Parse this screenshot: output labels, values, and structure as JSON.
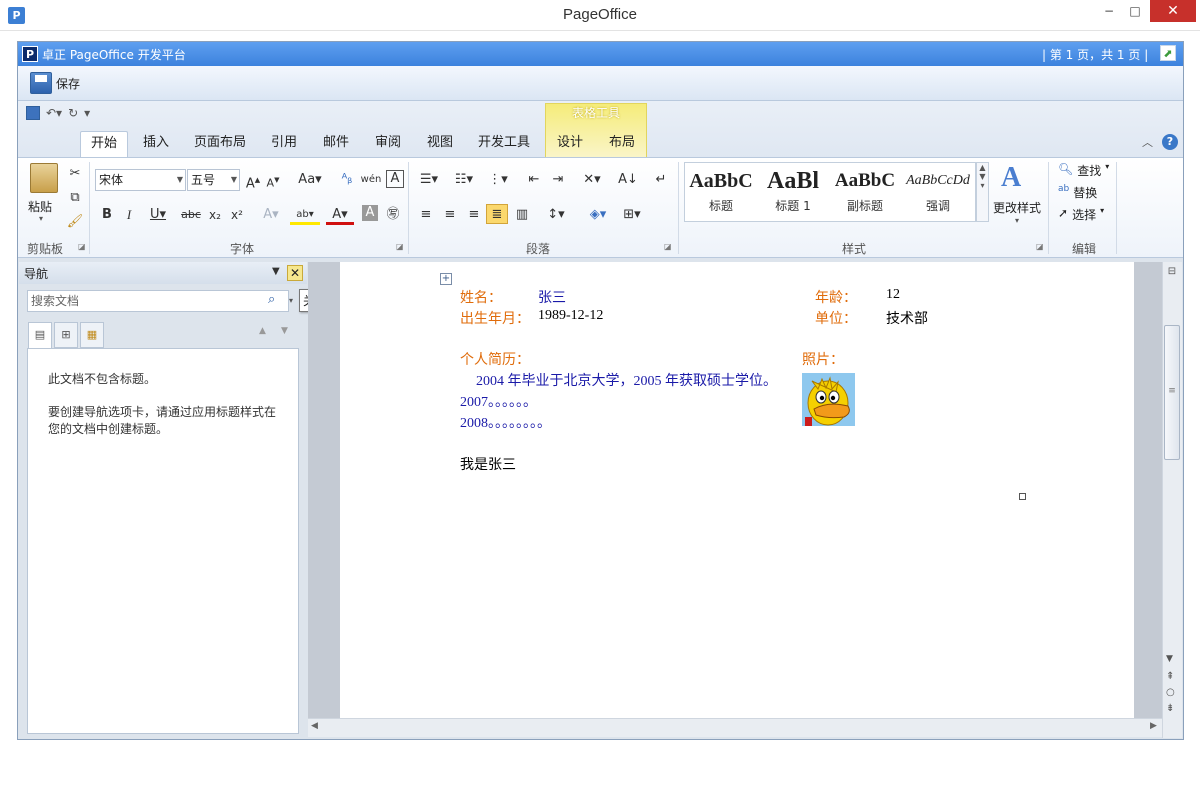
{
  "window": {
    "title": "PageOffice",
    "app_icon": "P",
    "min": "−",
    "max": "□",
    "close": "✕"
  },
  "po": {
    "logo": "P",
    "title": "卓正 PageOffice 开发平台",
    "page_info": "| 第 1 页，共 1 页 |",
    "save_label": "保存"
  },
  "ribbon": {
    "context_group": "表格工具",
    "tabs": [
      "开始",
      "插入",
      "页面布局",
      "引用",
      "邮件",
      "审阅",
      "视图",
      "开发工具",
      "设计",
      "布局"
    ],
    "groups": {
      "clipboard": "剪贴板",
      "font": "字体",
      "paragraph": "段落",
      "styles": "样式",
      "editing": "编辑"
    },
    "paste_label": "粘贴",
    "font_name": "宋体",
    "font_size": "五号",
    "change_styles": "更改样式",
    "styles": [
      {
        "sample": "AaBbC",
        "name": "标题"
      },
      {
        "sample": "AaBl",
        "name": "标题 1"
      },
      {
        "sample": "AaBbC",
        "name": "副标题"
      },
      {
        "sample": "AaBbCcDd",
        "name": "强调"
      }
    ],
    "editing": {
      "find": "查找",
      "replace": "替换",
      "select": "选择"
    }
  },
  "nav": {
    "title": "导航",
    "close_tooltip": "关闭",
    "search_placeholder": "搜索文档",
    "message1": "此文档不包含标题。",
    "message2": "要创建导航选项卡，请通过应用标题样式在您的文档中创建标题。"
  },
  "document": {
    "name_label": "姓名：",
    "name_value": "张三",
    "age_label": "年龄：",
    "age_value": "12",
    "birth_label": "出生年月：",
    "birth_value": "1989-12-12",
    "unit_label": "单位：",
    "unit_value": "技术部",
    "resume_label": "个人简历：",
    "photo_label": "照片：",
    "resume_lines": [
      "2004 年毕业于北京大学，2005 年获取硕士学位。",
      "2007。。。。。。",
      "2008。。。。。。。。"
    ],
    "footer_text": "我是张三"
  },
  "colors": {
    "label": "#e06c0b",
    "value_blue": "#1a1aa8",
    "close_button": "#c7302b",
    "po_titlebar": "#3c82dd"
  },
  "icons": [
    "app-icon",
    "save-icon",
    "undo-icon",
    "redo-icon",
    "help-icon",
    "search-icon",
    "close-icon",
    "duck-photo"
  ]
}
